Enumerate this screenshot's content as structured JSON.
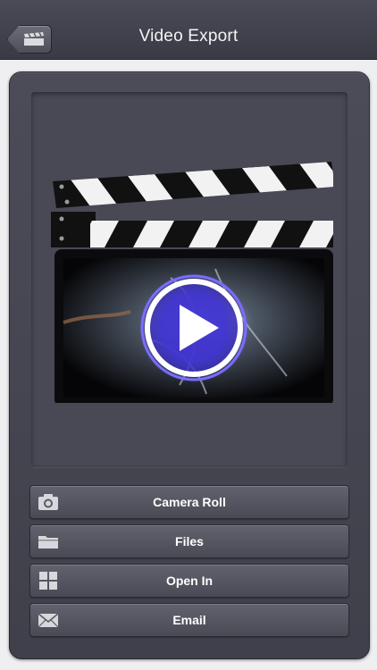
{
  "navbar": {
    "title": "Video Export",
    "back_icon": "clapperboard-icon"
  },
  "preview": {
    "icon": "video-play-icon"
  },
  "actions": [
    {
      "label": "Camera Roll",
      "icon": "camera-icon"
    },
    {
      "label": "Files",
      "icon": "folder-icon"
    },
    {
      "label": "Open In",
      "icon": "grid-icon"
    },
    {
      "label": "Email",
      "icon": "envelope-icon"
    }
  ],
  "colors": {
    "navbar": "#3f3f4a",
    "panel": "#454551",
    "button": "#575762",
    "play_ring": "#7a6cff"
  }
}
